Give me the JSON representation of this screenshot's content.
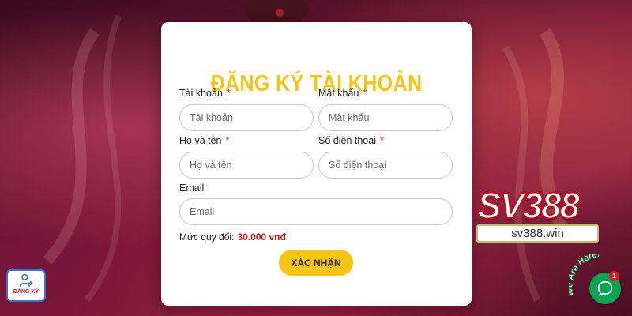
{
  "form": {
    "title": "ĐĂNG KÝ TÀI KHOẢN",
    "fields": {
      "username": {
        "label": "Tài khoản",
        "required_mark": "*",
        "placeholder": "Tài khoản",
        "value": ""
      },
      "password": {
        "label": "Mật khẩu",
        "required_mark": "*",
        "placeholder": "Mật khẩu",
        "value": ""
      },
      "fullname": {
        "label": "Họ và tên",
        "required_mark": "*",
        "placeholder": "Họ và tên",
        "value": ""
      },
      "phone": {
        "label": "Số điện thoại",
        "required_mark": "*",
        "placeholder": "Số điện thoại",
        "value": ""
      },
      "email": {
        "label": "Email",
        "placeholder": "Email",
        "value": ""
      }
    },
    "rate_label": "Mức quy đổi:",
    "rate_value": "30.000 vnđ",
    "submit_label": "XÁC NHẬN"
  },
  "brand": {
    "logo_text": "SV388",
    "domain": "sv388.win"
  },
  "register_widget": {
    "label": "ĐĂNG KÝ",
    "icon": "add-user-icon"
  },
  "chat": {
    "tagline": "We Are Here!",
    "badge_count": "1",
    "icon": "chat-bubble-icon"
  },
  "colors": {
    "accent_yellow": "#f5c414",
    "required_red": "#e0192b",
    "rate_red": "#d4141d",
    "chat_green": "#0aa34f",
    "background": "#6e1636"
  }
}
